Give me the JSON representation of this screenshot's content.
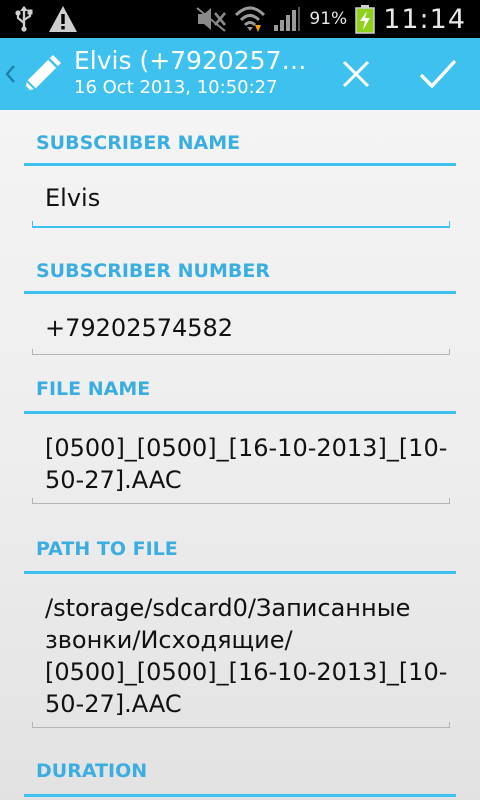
{
  "status_bar": {
    "battery_percent": "91%",
    "time": "11:14",
    "icons": [
      "usb-icon",
      "warning-icon",
      "mute-icon",
      "wifi-icon",
      "signal-icon",
      "battery-charging-icon"
    ]
  },
  "action_bar": {
    "title": "Elvis (+79202574582)",
    "subtitle": "16 Oct 2013, 10:50:27",
    "icons": [
      "up-caret-icon",
      "pencil-icon",
      "close-icon",
      "check-icon"
    ]
  },
  "sections": {
    "subscriber_name": {
      "label": "SUBSCRIBER NAME",
      "value": "Elvis"
    },
    "subscriber_number": {
      "label": "SUBSCRIBER NUMBER",
      "value": "+79202574582"
    },
    "file_name": {
      "label": "FILE NAME",
      "value": "[0500]_[0500]_[16-10-2013]_[10-\n50-27].AAC"
    },
    "path_to_file": {
      "label": "PATH TO FILE",
      "value": "/storage/sdcard0/Записанные\nзвонки/Исходящие/\n[0500]_[0500]_[16-10-2013]_[10-\n50-27].AAC"
    },
    "duration": {
      "label": "DURATION"
    }
  },
  "colors": {
    "accent": "#3fc1ef",
    "section_label": "#3aaee0",
    "status_bar": "#000000",
    "battery_charging": "#8fd11c"
  }
}
